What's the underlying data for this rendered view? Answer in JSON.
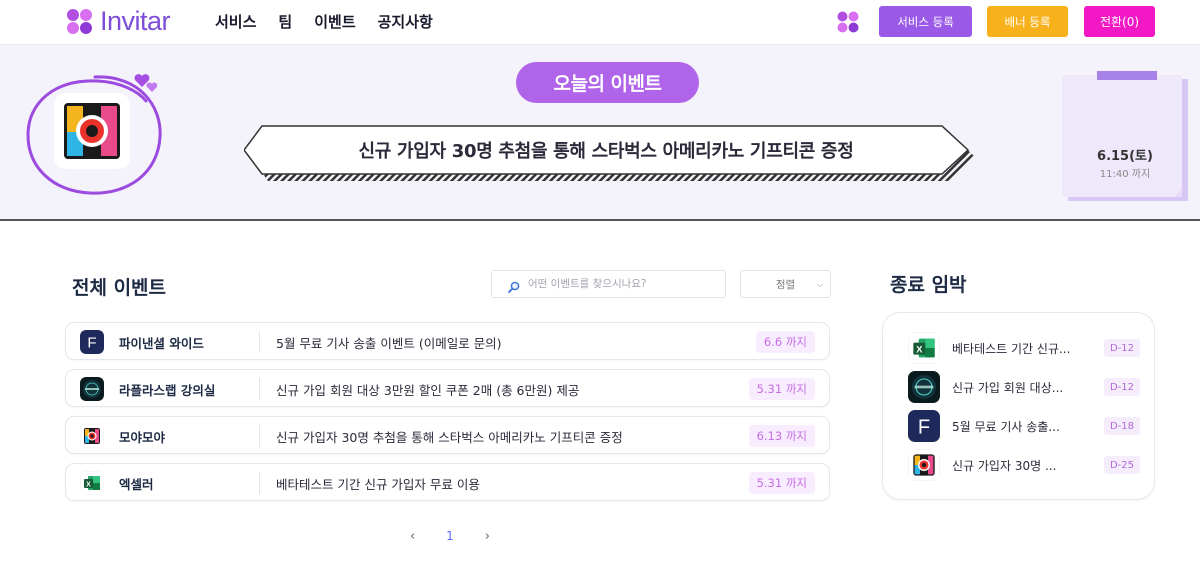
{
  "header": {
    "logo_text": "Invitar",
    "nav": [
      "서비스",
      "팀",
      "이벤트",
      "공지사항"
    ],
    "buttons": {
      "service": "서비스 등록",
      "banner": "배너 등록",
      "switch": "전환(0)"
    }
  },
  "banner": {
    "today_label": "오늘의 이벤트",
    "event_text": "신규 가입자 30명 추첨을 통해 스타벅스 아메리카노 기프티콘 증정",
    "date": "6.15(토)",
    "time": "11:40 까지"
  },
  "events": {
    "title": "전체 이벤트",
    "search_placeholder": "어떤 이벤트를 찾으시나요?",
    "sort_label": "정렬",
    "rows": [
      {
        "name": "파이낸셜 와이드",
        "desc": "5월 무료 기사 송출 이벤트 (이메일로 문의)",
        "badge": "6.6 까지",
        "icon": "financial-wide-f-icon"
      },
      {
        "name": "라플라스랩 강의실",
        "desc": "신규 가입 회원 대상 3만원 할인 쿠폰 2매 (총 6만원) 제공",
        "badge": "5.31 까지",
        "icon": "laplace-lab-icon"
      },
      {
        "name": "모야모야",
        "desc": "신규 가입자 30명 추첨을 통해 스타벅스 아메리카노 기프티콘 증정",
        "badge": "6.13 까지",
        "icon": "moyamoya-camera-icon"
      },
      {
        "name": "엑셀러",
        "desc": "베타테스트 기간 신규 가입자 무료 이용",
        "badge": "5.31 까지",
        "icon": "excel-icon"
      }
    ],
    "page": "1"
  },
  "ending": {
    "title": "종료 임박",
    "items": [
      {
        "text": "베타테스트 기간 신규...",
        "badge": "D-12",
        "icon": "excel-icon"
      },
      {
        "text": "신규 가입 회원 대상...",
        "badge": "D-12",
        "icon": "laplace-lab-icon"
      },
      {
        "text": "5월 무료 기사 송출...",
        "badge": "D-18",
        "icon": "financial-wide-f-icon"
      },
      {
        "text": "신규 가입자 30명 ...",
        "badge": "D-25",
        "icon": "moyamoya-camera-icon"
      }
    ]
  },
  "colors": {
    "brand_purple": "#9b59e8",
    "banner_button": "#f7b21b",
    "switch_button": "#f218c6",
    "badge_text": "#c76ee6"
  }
}
